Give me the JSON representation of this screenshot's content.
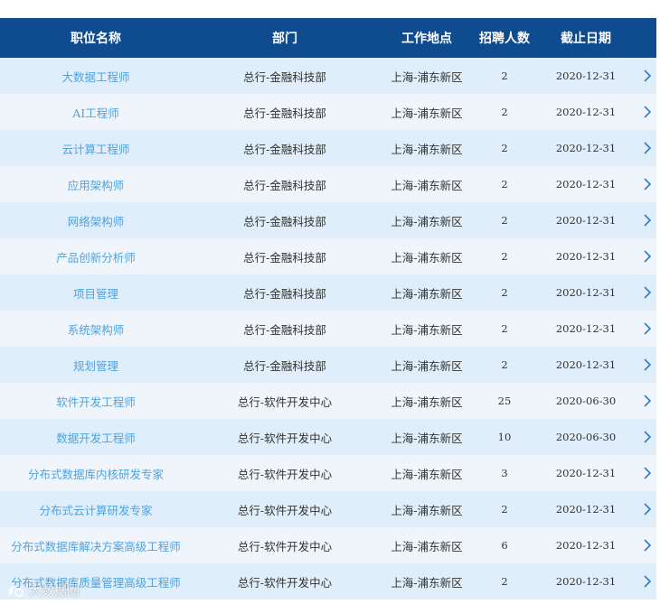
{
  "table": {
    "headers": {
      "title": "职位名称",
      "department": "部门",
      "location": "工作地点",
      "count": "招聘人数",
      "deadline": "截止日期"
    },
    "rows": [
      {
        "title": "大数据工程师",
        "department": "总行-金融科技部",
        "location": "上海-浦东新区",
        "count": "2",
        "deadline": "2020-12-31"
      },
      {
        "title": "AI工程师",
        "department": "总行-金融科技部",
        "location": "上海-浦东新区",
        "count": "2",
        "deadline": "2020-12-31"
      },
      {
        "title": "云计算工程师",
        "department": "总行-金融科技部",
        "location": "上海-浦东新区",
        "count": "2",
        "deadline": "2020-12-31"
      },
      {
        "title": "应用架构师",
        "department": "总行-金融科技部",
        "location": "上海-浦东新区",
        "count": "2",
        "deadline": "2020-12-31"
      },
      {
        "title": "网络架构师",
        "department": "总行-金融科技部",
        "location": "上海-浦东新区",
        "count": "2",
        "deadline": "2020-12-31"
      },
      {
        "title": "产品创新分析师",
        "department": "总行-金融科技部",
        "location": "上海-浦东新区",
        "count": "2",
        "deadline": "2020-12-31"
      },
      {
        "title": "项目管理",
        "department": "总行-金融科技部",
        "location": "上海-浦东新区",
        "count": "2",
        "deadline": "2020-12-31"
      },
      {
        "title": "系统架构师",
        "department": "总行-金融科技部",
        "location": "上海-浦东新区",
        "count": "2",
        "deadline": "2020-12-31"
      },
      {
        "title": "规划管理",
        "department": "总行-金融科技部",
        "location": "上海-浦东新区",
        "count": "2",
        "deadline": "2020-12-31"
      },
      {
        "title": "软件开发工程师",
        "department": "总行-软件开发中心",
        "location": "上海-浦东新区",
        "count": "25",
        "deadline": "2020-06-30"
      },
      {
        "title": "数据开发工程师",
        "department": "总行-软件开发中心",
        "location": "上海-浦东新区",
        "count": "10",
        "deadline": "2020-06-30"
      },
      {
        "title": "分布式数据库内核研发专家",
        "department": "总行-软件开发中心",
        "location": "上海-浦东新区",
        "count": "3",
        "deadline": "2020-12-31"
      },
      {
        "title": "分布式云计算研发专家",
        "department": "总行-软件开发中心",
        "location": "上海-浦东新区",
        "count": "2",
        "deadline": "2020-12-31"
      },
      {
        "title": "分布式数据库解决方案高级工程师",
        "department": "总行-软件开发中心",
        "location": "上海-浦东新区",
        "count": "6",
        "deadline": "2020-12-31"
      },
      {
        "title": "分布式数据库质量管理高级工程师",
        "department": "总行-软件开发中心",
        "location": "上海-浦东新区",
        "count": "2",
        "deadline": "2020-12-31"
      }
    ]
  },
  "watermark": {
    "text": "大数据圈"
  },
  "colors": {
    "header_bg": "#0f4c8f",
    "row_odd": "#dfeefa",
    "row_even": "#eff5fb",
    "link": "#4fa3e0",
    "chevron": "#2a7fd0"
  }
}
